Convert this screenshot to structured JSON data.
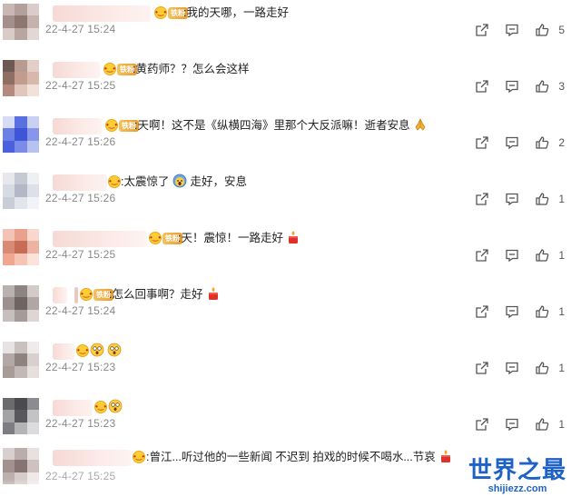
{
  "comments": [
    {
      "text": ":我的天哪，一路走好",
      "time": "22-4-27 15:24",
      "likes": "5",
      "badge": "铁粉",
      "trail_emoji": ""
    },
    {
      "text": ":黄药师？？怎么会这样",
      "time": "22-4-27 15:25",
      "likes": "3",
      "badge": "铁粉",
      "trail_emoji": ""
    },
    {
      "text": ":天啊！这不是《纵横四海》里那个大反派嘛！逝者安息",
      "time": "22-4-27 15:26",
      "likes": "2",
      "badge": "铁粉",
      "trail_emoji": "pray"
    },
    {
      "text": ":太震惊了",
      "text2": "走好，安息",
      "time": "22-4-27 15:26",
      "likes": "1",
      "badge": "",
      "trail_emoji": ""
    },
    {
      "text": ":天！震惊！一路走好",
      "time": "22-4-27 15:25",
      "likes": "1",
      "badge": "铁粉",
      "trail_emoji": "candle"
    },
    {
      "text": ":怎么回事啊？走好",
      "time": "22-4-27 15:24",
      "likes": "1",
      "badge": "铁粉",
      "trail_emoji": "candle"
    },
    {
      "text": "",
      "time": "22-4-27 15:23",
      "likes": "1",
      "badge": "",
      "trail_emoji": ""
    },
    {
      "text": "",
      "time": "22-4-27 15:23",
      "likes": "1",
      "badge": "",
      "trail_emoji": ""
    },
    {
      "text": ":曾江...听过他的一些新闻 不迟到 拍戏的时候不喝水...节哀",
      "time": "22-4-27 15:25",
      "likes": "",
      "badge": "",
      "trail_emoji": "candle"
    }
  ],
  "colors": {
    "accent": "#1e62c8",
    "time": "#888888",
    "icon": "#555555"
  },
  "icons": {
    "share": "share-icon",
    "comment": "comment-icon",
    "like": "thumbs-up-icon"
  },
  "watermark": {
    "title": "世界之最",
    "url": "shijiezz.com"
  }
}
